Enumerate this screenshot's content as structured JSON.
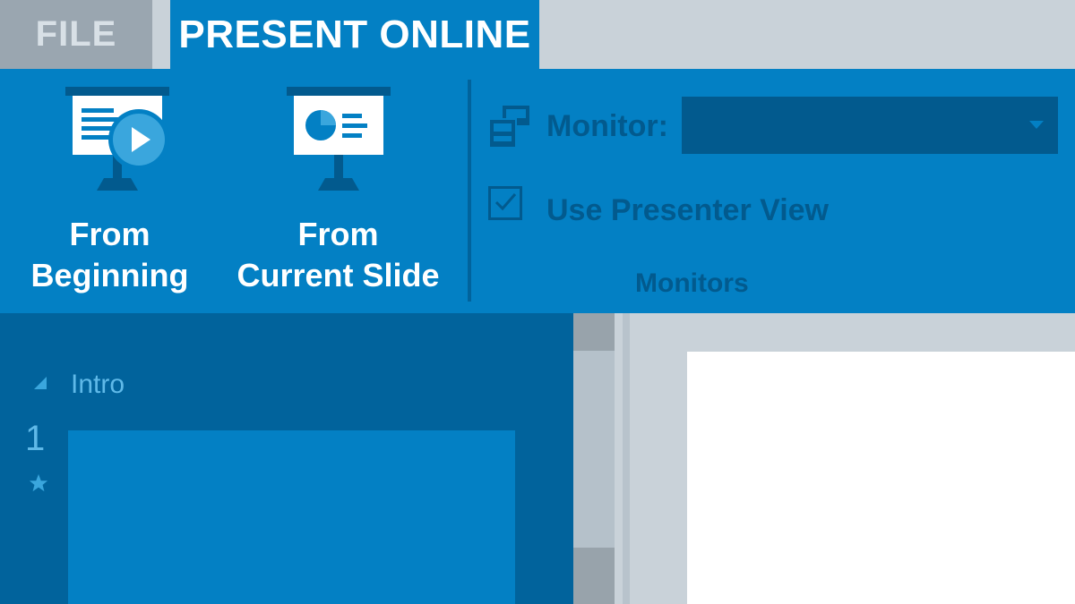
{
  "tabs": {
    "file_label": "FILE",
    "present_label": "PRESENT ONLINE"
  },
  "ribbon": {
    "from_beginning_label": "From\nBeginning",
    "from_current_label": "From\nCurrent Slide",
    "monitor_label": "Monitor:",
    "monitor_value": "",
    "presenter_view_label": "Use Presenter View",
    "presenter_view_checked": true,
    "group_label": "Monitors"
  },
  "slides_panel": {
    "section_label": "Intro",
    "slide_number": "1"
  },
  "icons": {
    "from_beginning": "presentation-play-icon",
    "from_current": "presentation-chart-icon",
    "monitor": "monitors-icon",
    "check": "check-icon",
    "star": "star-icon"
  },
  "colors": {
    "accent": "#0380c4",
    "accent_dark": "#01639c",
    "accent_darker": "#025a8e",
    "background": "#c9d2d9",
    "tab_inactive": "#9aa6b0"
  }
}
